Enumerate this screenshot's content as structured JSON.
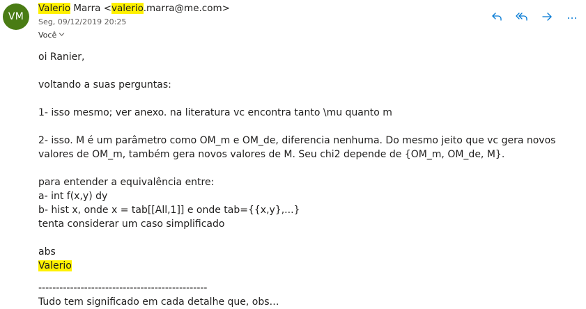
{
  "sender": {
    "avatar_initials": "VM",
    "name": "Valerio",
    "name_rest": " Marra",
    "email_open": " <",
    "email_highlight": "valerio",
    "email_rest": ".marra@me.com>",
    "date": "Seg, 09/12/2019 20:25",
    "to": "Você",
    "avatar_color": "#4a7c14",
    "highlight_color": "#fff100"
  },
  "actions": {
    "reply_icon": "reply-icon",
    "reply_all_icon": "reply-all-icon",
    "forward_icon": "forward-icon",
    "more_icon": "more-icon",
    "accent_color": "#0078d4"
  },
  "body": {
    "greeting": "oi Ranier,",
    "intro": "voltando a suas perguntas:",
    "item1": "1- isso mesmo; ver anexo. na literatura vc encontra tanto \\mu quanto m",
    "item2": "2- isso. M é um parâmetro como OM_m e OM_de, diferencia nenhuma. Do mesmo jeito que vc gera novos valores de OM_m, também gera novos valores de M. Seu chi2 depende de {OM_m, OM_de, M}.",
    "equiv_intro": "para entender a equivalência entre:",
    "equiv_a": "a- int f(x,y) dy",
    "equiv_b": "b- hist x, onde x = tab[[All,1]] e onde tab={{x,y},...}",
    "equiv_tail": "tenta considerar um caso simplificado",
    "closing": "abs",
    "signature": "Valerio",
    "separator": "------------------------------------------------",
    "quoted_cut": "Tudo tem significado em cada detalhe que, obs…"
  }
}
